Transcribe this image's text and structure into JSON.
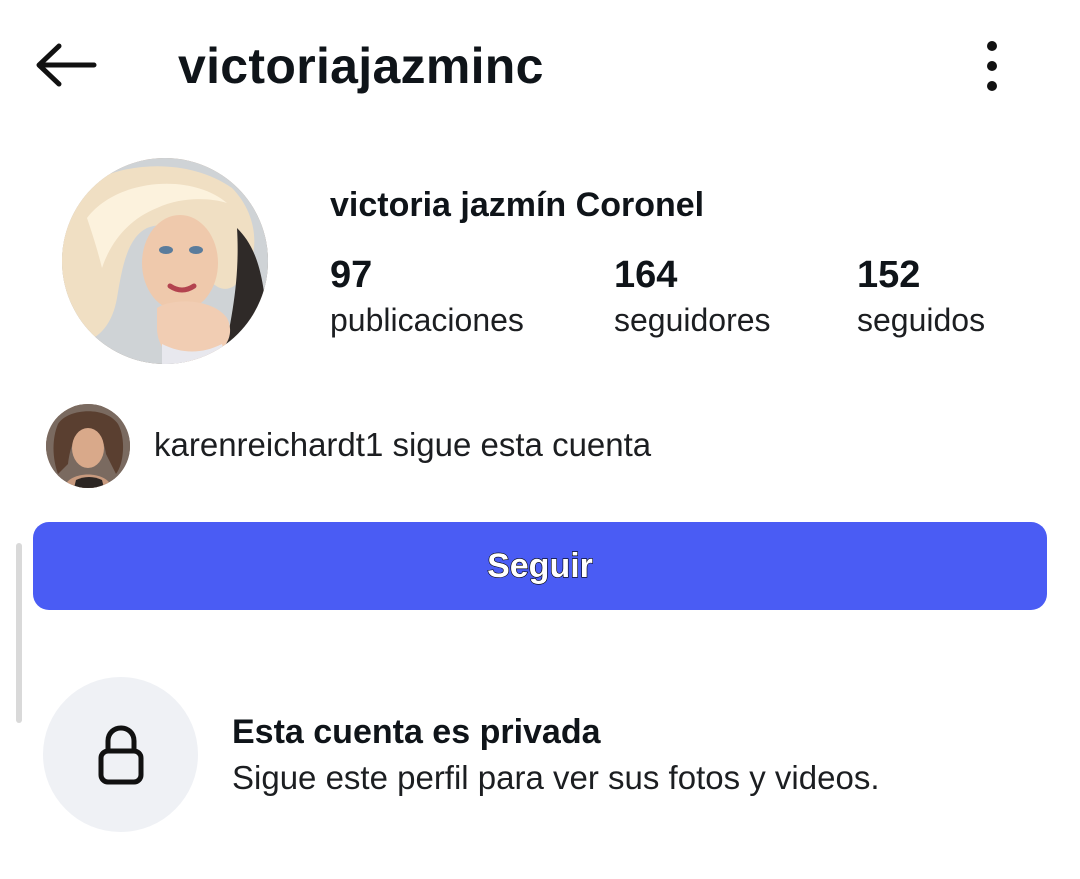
{
  "header": {
    "username": "victoriajazminc",
    "back_icon": "arrow-left-icon",
    "more_icon": "vertical-dots-icon"
  },
  "profile": {
    "full_name": "victoria jazmín Coronel",
    "stats": {
      "posts": {
        "value": "97",
        "label": "publicaciones"
      },
      "followers": {
        "value": "164",
        "label": "seguidores"
      },
      "following": {
        "value": "152",
        "label": "seguidos"
      }
    }
  },
  "mutual": {
    "text": "karenreichardt1 sigue esta cuenta"
  },
  "follow_button": {
    "label": "Seguir",
    "color": "#4a5cf4"
  },
  "private_notice": {
    "title": "Esta cuenta es privada",
    "subtitle": "Sigue este perfil para ver sus fotos y videos.",
    "icon": "lock-icon"
  }
}
